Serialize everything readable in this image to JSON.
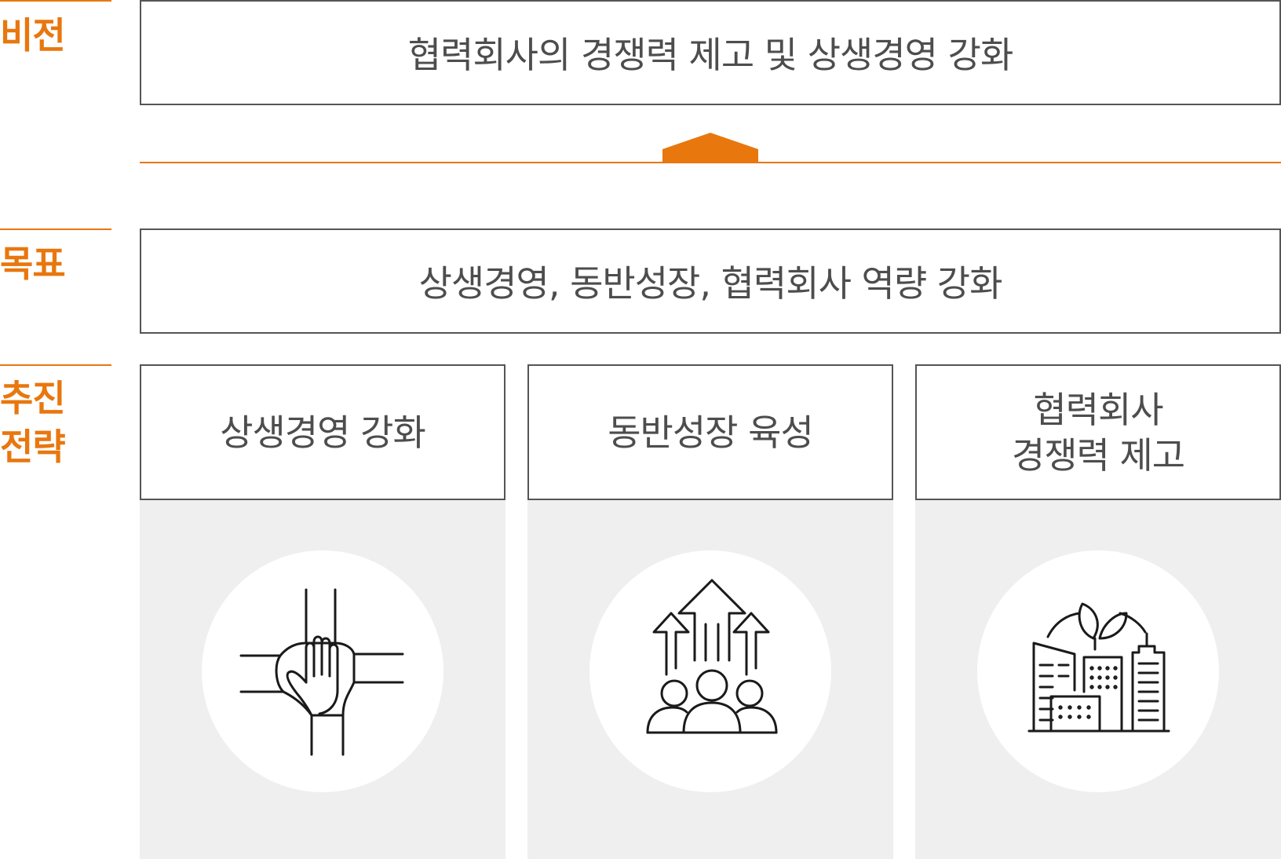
{
  "labels": {
    "vision": "비전",
    "goal": "목표",
    "strategy_line1": "추진",
    "strategy_line2": "전략"
  },
  "vision_text": "협력회사의 경쟁력 제고 및 상생경영 강화",
  "goal_text": "상생경영, 동반성장, 협력회사 역량 강화",
  "strategies": [
    {
      "line1": "상생경영 강화",
      "line2": "",
      "icon": "handshake-hands-icon"
    },
    {
      "line1": "동반성장 육성",
      "line2": "",
      "icon": "people-growth-arrows-icon"
    },
    {
      "line1": "협력회사",
      "line2": "경쟁력 제고",
      "icon": "eco-city-buildings-icon"
    }
  ],
  "colors": {
    "accent": "#e8770e",
    "border": "#555555",
    "text": "#4d4d4d",
    "panel": "#efefef"
  }
}
